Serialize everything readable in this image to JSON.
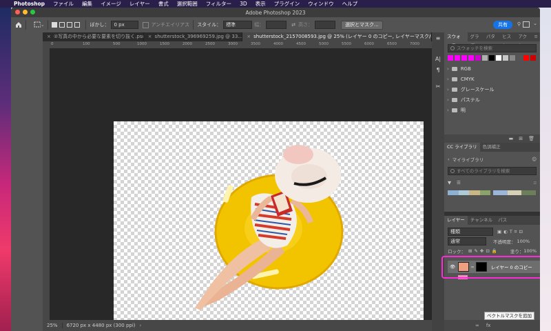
{
  "menubar": {
    "apple": "",
    "app": "Photoshop",
    "items": [
      "ファイル",
      "編集",
      "イメージ",
      "レイヤー",
      "書式",
      "選択範囲",
      "フィルター",
      "3D",
      "表示",
      "プラグイン",
      "ウィンドウ",
      "ヘルプ"
    ]
  },
  "window": {
    "title": "Adobe Photoshop 2023"
  },
  "options": {
    "feather_label": "ぼかし：",
    "feather_value": "0 px",
    "antialias": "アンチエイリアス",
    "style_label": "スタイル：",
    "style_value": "標準",
    "width_label": "幅：",
    "height_label": "高さ：",
    "select_mask": "選択とマスク...",
    "share": "共有"
  },
  "tabs": [
    {
      "label": "②写真の中から必要な要素を切り抜く.psd"
    },
    {
      "label": "shutterstock_396969259.jpg @ 33...."
    },
    {
      "label": "shutterstock_2157008593.jpg @ 25% (レイヤー 0 のコピー, レイヤーマスク/8) *"
    }
  ],
  "ruler": [
    "0",
    "100",
    "500",
    "1000",
    "1500",
    "2000",
    "2500",
    "3000",
    "3500",
    "4000",
    "4500",
    "5000",
    "5500",
    "6000",
    "6500",
    "7000"
  ],
  "status": {
    "zoom": "25%",
    "info": "6720 px x 4480 px (300 ppi)"
  },
  "swatch_panel": {
    "tabs": [
      "スウォッチ",
      "グラデ",
      "パター",
      "ヒスト",
      "アクシ"
    ],
    "search_placeholder": "スウォッチを検索",
    "colors": [
      "#ff00ff",
      "#ff00ff",
      "#ff00ff",
      "#ff00ff",
      "#cc00cc",
      "#b0b0b0",
      "#000000",
      "#ffffff",
      "#c8c8c8",
      "#888888",
      "#555555",
      "#ff0000",
      "#cc0000",
      "#ee2222"
    ],
    "folders": [
      "RGB",
      "CMYK",
      "グレースケール",
      "パステル",
      "明"
    ]
  },
  "cc_panel": {
    "tabs": [
      "CC ライブラリ",
      "色調補正"
    ],
    "library": "マイライブラリ",
    "search_placeholder": "すべてのライブラリを検索"
  },
  "layers_panel": {
    "tabs": [
      "レイヤー",
      "チャンネル",
      "パス"
    ],
    "filter": "種類",
    "blend": "通常",
    "opacity_label": "不透明度：",
    "opacity": "100%",
    "lock_label": "ロック：",
    "fill_label": "塗り：",
    "fill": "100%",
    "layer_name": "レイヤー 0 のコピー"
  },
  "tooltip": "ベクトルマスクを追加"
}
